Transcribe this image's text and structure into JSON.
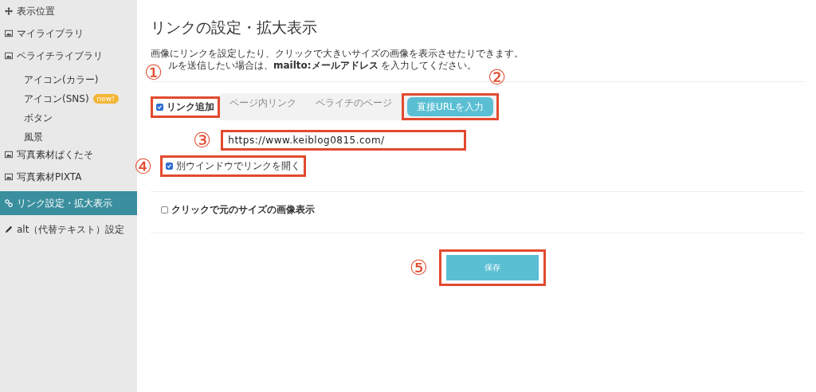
{
  "sidebar": {
    "items": [
      {
        "label": "表示位置",
        "kind": "move",
        "selected": false
      },
      {
        "label": "マイライブラリ",
        "kind": "image",
        "selected": false
      },
      {
        "label": "ペライチライブラリ",
        "kind": "image",
        "selected": false,
        "children": [
          {
            "label": "アイコン(カラー)"
          },
          {
            "label": "アイコン(SNS)",
            "badge": "new!"
          },
          {
            "label": "ボタン"
          },
          {
            "label": "風景"
          }
        ]
      },
      {
        "label": "写真素材ぱくたそ",
        "kind": "image",
        "selected": false
      },
      {
        "label": "写真素材PIXTA",
        "kind": "image",
        "selected": false
      },
      {
        "label": "リンク設定・拡大表示",
        "kind": "link",
        "selected": true
      },
      {
        "label": "alt（代替テキスト）設定",
        "kind": "pen",
        "selected": false
      }
    ]
  },
  "main": {
    "title": "リンクの設定・拡大表示",
    "description": [
      "画像にリンクを設定したり、クリックで大きいサイズの画像を表示させたりできます。",
      "ルを送信したい場合は、**mailto:メールアドレス** を入力してください。"
    ],
    "link_checkbox": {
      "label": "リンク追加",
      "checked": true,
      "highlighted": true,
      "marker": "①"
    },
    "link_tabs": {
      "marker": "②",
      "tabs": [
        {
          "label": "ページ内リンク",
          "selected": false
        },
        {
          "label": "ペライチのページ",
          "selected": false
        },
        {
          "label": "直接URLを入力",
          "selected": true,
          "highlighted": true
        }
      ]
    },
    "url_field": {
      "value": "https://www.keiblog0815.com/",
      "highlighted": true,
      "marker": "③"
    },
    "new_window_checkbox": {
      "label": "別ウインドウでリンクを開く",
      "checked": true,
      "highlighted": true,
      "marker": "④"
    },
    "zoom_checkbox": {
      "label": "クリックで元のサイズの画像表示",
      "checked": false
    },
    "save_button": {
      "label": "保存",
      "highlighted": true,
      "marker": "⑤"
    }
  }
}
